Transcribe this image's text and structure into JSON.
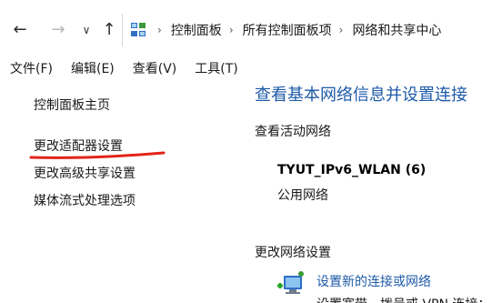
{
  "nav": {
    "back_glyph": "←",
    "forward_glyph": "→",
    "dropdown_glyph": "∨",
    "up_glyph": "↑"
  },
  "breadcrumb": {
    "separator": "›",
    "items": [
      "控制面板",
      "所有控制面板项",
      "网络和共享中心"
    ]
  },
  "menubar": {
    "items": [
      "文件(F)",
      "编辑(E)",
      "查看(V)",
      "工具(T)"
    ]
  },
  "sidebar": {
    "items": [
      "控制面板主页",
      "更改适配器设置",
      "更改高级共享设置",
      "媒体流式处理选项"
    ]
  },
  "main": {
    "title": "查看基本网络信息并设置连接",
    "active_networks_heading": "查看活动网络",
    "network_name": "TYUT_IPv6_WLAN  (6)",
    "network_category": "公用网络",
    "change_settings_heading": "更改网络设置",
    "setup_link": "设置新的连接或网络",
    "setup_desc": "设置宽带、拨号或 VPN 连接；"
  },
  "colors": {
    "link_blue": "#1e5aa8",
    "annotation_red": "#e2241b"
  }
}
